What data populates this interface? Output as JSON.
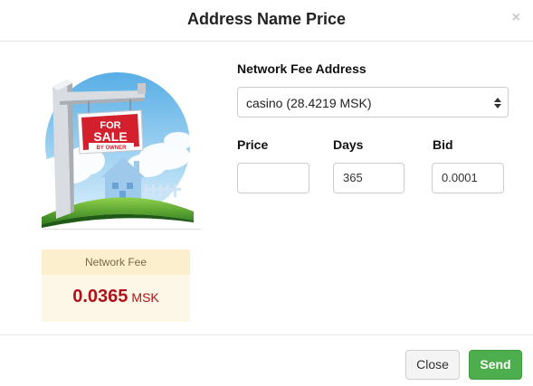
{
  "dialog": {
    "title": "Address Name Price",
    "close_glyph": "×"
  },
  "illustration": {
    "sign_line1": "FOR",
    "sign_line2": "SALE",
    "sign_line3": "BY OWNER",
    "icon": "for-sale-sign-illustration"
  },
  "fee": {
    "label": "Network Fee",
    "value": "0.0365",
    "unit": "MSK"
  },
  "form": {
    "fee_address_label": "Network Fee Address",
    "fee_address_selected": "casino (28.4219 MSK)",
    "price_label": "Price",
    "price_value": "",
    "days_label": "Days",
    "days_value": "365",
    "bid_label": "Bid",
    "bid_value": "0.0001"
  },
  "buttons": {
    "close_label": "Close",
    "send_label": "Send"
  },
  "colors": {
    "fee_value": "#b1111b",
    "send_button": "#4cae4c",
    "fee_box": "#fcf7e6"
  }
}
